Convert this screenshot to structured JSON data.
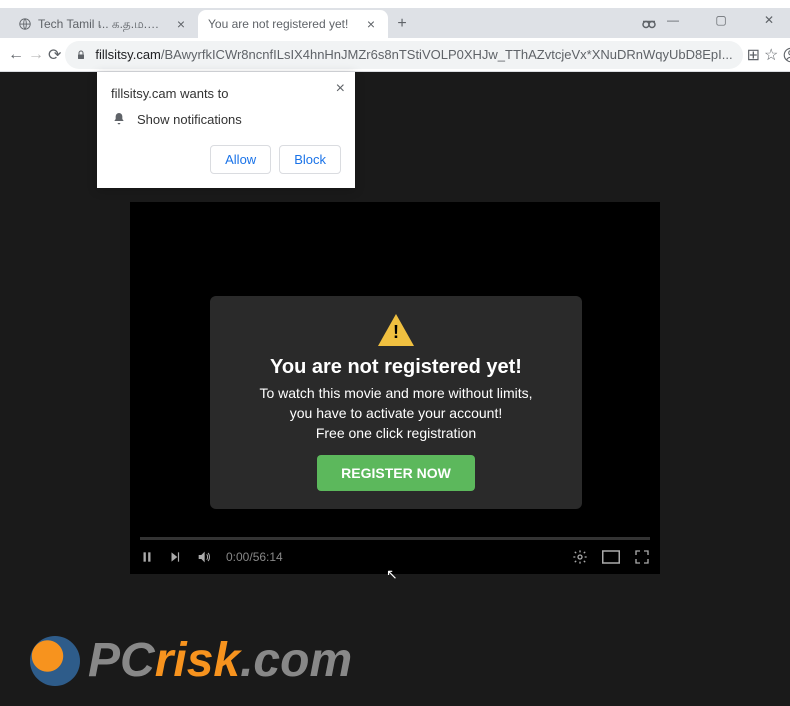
{
  "tabs": [
    {
      "title": "Tech Tamil เ.. க.த.ம.ழ Tips And"
    },
    {
      "title": "You are not registered yet!"
    }
  ],
  "window": {
    "minimize": "—",
    "maximize": "▢",
    "close": "✕"
  },
  "nav": {
    "back": "←",
    "forward": "→",
    "reload": "⟳"
  },
  "address": {
    "domain": "fillsitsy.cam",
    "path": "/BAwyrfkICWr8ncnfILsIX4hnHnJMZr6s8nTStiVOLP0XHJw_TThAZvtcjeVx*XNuDRnWqyUbD8EpI..."
  },
  "toolbar_icons": {
    "apps": "⊞",
    "star": "☆",
    "account": "◯",
    "menu": "⋮"
  },
  "notif": {
    "title": "fillsitsy.cam wants to",
    "perm": "Show notifications",
    "allow": "Allow",
    "block": "Block"
  },
  "overlay": {
    "title": "You are not registered yet!",
    "line1": "To watch this movie and more without limits,",
    "line2": "you have to activate your account!",
    "free": "Free one click registration",
    "button": "REGISTER NOW"
  },
  "player": {
    "time": "0:00/56:14"
  },
  "watermark": {
    "pc": "PC",
    "risk": "risk",
    "com": ".com"
  }
}
